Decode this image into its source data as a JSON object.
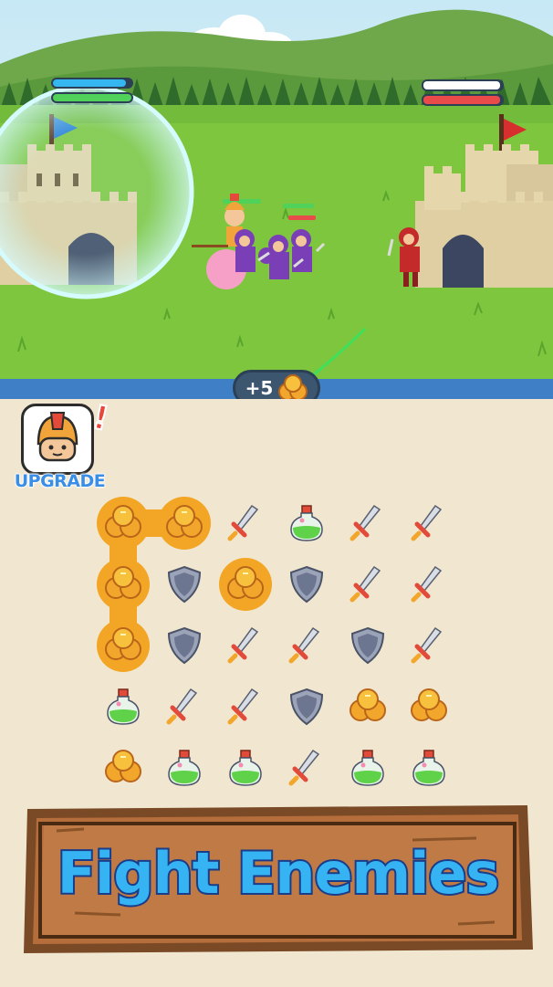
{
  "game": {
    "reward": {
      "label": "+5",
      "icon": "coin-stack-icon"
    },
    "upgrade": {
      "label": "UPGRADE",
      "alert": "!",
      "icon": "knight-helmet-icon"
    },
    "banner": {
      "text": "Fight Enemies"
    },
    "player_castle": {
      "flag_color": "#2a7fd8",
      "health_bar_color": "#34b6f0",
      "energy_bar_color": "#4fd15a"
    },
    "enemy_castle": {
      "flag_color": "#d72e2e",
      "health_bar_color": "#ffffff",
      "energy_bar_color": "#e94b4b"
    },
    "board": {
      "rows": [
        [
          "coin",
          "coin",
          "sword",
          "potion",
          "sword",
          "sword"
        ],
        [
          "coin",
          "shield",
          "coin",
          "shield",
          "sword",
          "sword"
        ],
        [
          "coin",
          "shield",
          "sword",
          "sword",
          "shield",
          "sword"
        ],
        [
          "potion",
          "sword",
          "sword",
          "shield",
          "coin",
          "coin"
        ],
        [
          "coin",
          "potion",
          "potion",
          "sword",
          "potion",
          "potion"
        ]
      ],
      "selected": [
        [
          0,
          0
        ],
        [
          0,
          1
        ],
        [
          1,
          0
        ],
        [
          1,
          2
        ],
        [
          2,
          0
        ]
      ]
    }
  }
}
